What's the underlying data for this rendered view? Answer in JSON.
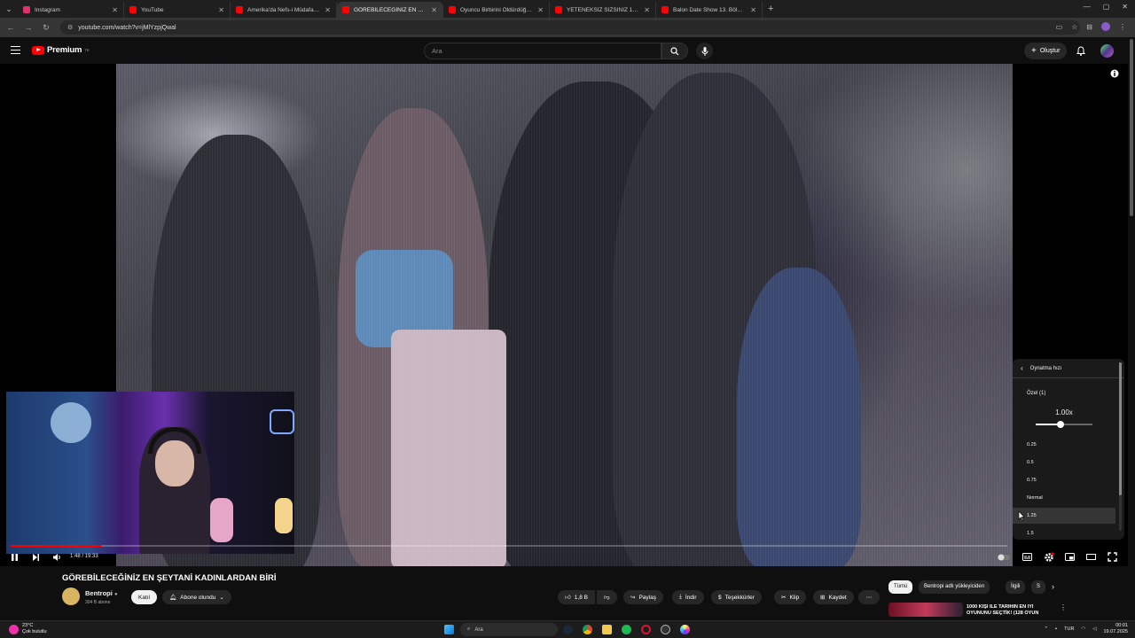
{
  "browser": {
    "tabs": [
      {
        "title": "Instagram",
        "color": "#e1306c"
      },
      {
        "title": "YouTube",
        "color": "#ff0000"
      },
      {
        "title": "Amerika'da Nefs-i Müdafaa - Y",
        "color": "#ff0000"
      },
      {
        "title": "GÖREBİLECEĞİNİZ EN ŞEYT",
        "color": "#ff0000",
        "active": true
      },
      {
        "title": "Oyuncu Birbirini Öldürdüğü Ku",
        "color": "#ff0000"
      },
      {
        "title": "YETENEKSİZ SIZSINIZ 1. BÖLÜM",
        "color": "#ff0000"
      },
      {
        "title": "Balon Date Show 13. Bölüm De",
        "color": "#ff0000"
      }
    ],
    "url": "youtube.com/watch?v=jMlYzpjQwal"
  },
  "youtube": {
    "logo_text": "Premium",
    "logo_sup": "TR",
    "search_placeholder": "Ara",
    "create_label": "Oluştur"
  },
  "player": {
    "time": "1:48 / 19:33",
    "progress": 0.092,
    "speed_menu": {
      "header": "Oynatma hızı",
      "custom_label": "Özel (1)",
      "current_speed": "1.00x",
      "slider_value": 0.5,
      "options": [
        "0.25",
        "0.5",
        "0.75",
        "Normal",
        "1.25",
        "1.5"
      ],
      "selected": "1.25"
    }
  },
  "video": {
    "title": "GÖREBİLECEĞİNİZ EN ŞEYTANİ KADINLARDAN BİRİ",
    "channel": "Bentropi",
    "subscribers": "304 B abone",
    "join_label": "Katıl",
    "subscribed_label": "Abone olundu",
    "likes": "1,8 B",
    "share_label": "Paylaş",
    "download_label": "İndir",
    "thanks_label": "Teşekkürler",
    "clip_label": "Klip",
    "save_label": "Kaydet",
    "more_label": "⋯"
  },
  "sidebar": {
    "chips": [
      "Tümü",
      "Bentropi adlı yükleyiciden",
      "İlgili",
      "S"
    ],
    "related_title": "1000 KİŞİ İLE TARİHİN EN İYİ OYUNUNU SEÇTİK! (128 OYUN"
  },
  "taskbar": {
    "weather_temp": "23°C",
    "weather_desc": "Çok bulutlu",
    "search_label": "Ara",
    "lang": "TUR",
    "time": "00:01",
    "date": "19.07.2025"
  }
}
